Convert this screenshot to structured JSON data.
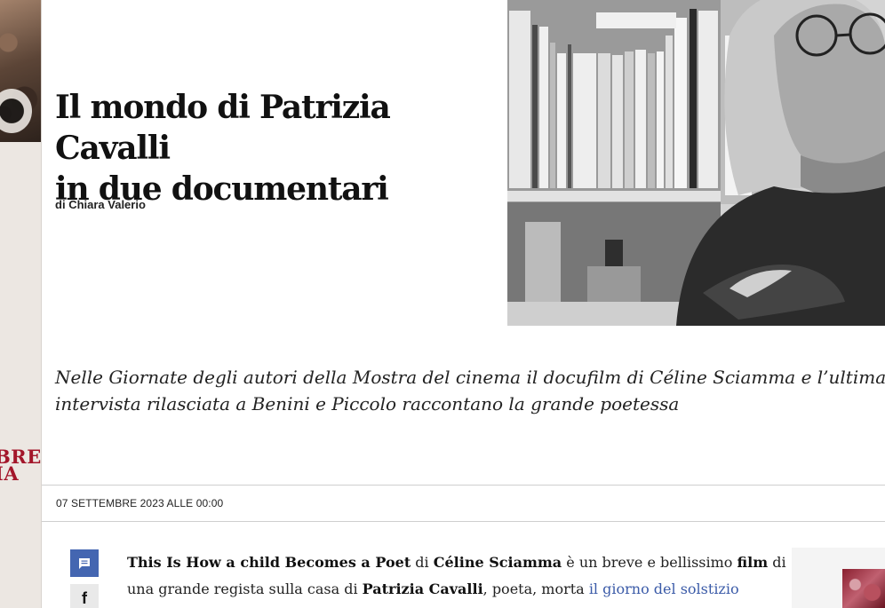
{
  "article": {
    "title_line1": "Il mondo di Patrizia Cavalli",
    "title_line2": "in due documentari",
    "byline_prefix": "di",
    "byline_author": "Chiara Valerio",
    "subtitle_line1": "Nelle Giornate degli autori della Mostra del cinema il docufilm di Céline Sciamma e l’ultima",
    "subtitle_line2": "intervista rilasciata a Benini e Piccolo raccontano la grande poetessa",
    "date": "07 SETTEMBRE 2023 ALLE 00:00"
  },
  "body": {
    "line1": {
      "film_title": "This Is How a child Becomes a Poet",
      "di": "di",
      "director": "Céline Sciamma",
      "text_a": "è un breve e bellissimo",
      "film_word": "film",
      "text_b": "di"
    },
    "line2": {
      "text_a": "una grande regista sulla casa di",
      "poet": "Patrizia Cavalli",
      "text_b": ", poeta, morta",
      "link": "il giorno del solstizio"
    }
  },
  "ad": {
    "line1": "BRE",
    "line2": "IA",
    "color": "#a3162a"
  },
  "share": {
    "comment_icon": "comment-icon",
    "facebook_label": "f",
    "comment_color": "#4466b1"
  },
  "colors": {
    "link": "#3b5ba8",
    "text": "#222222"
  }
}
